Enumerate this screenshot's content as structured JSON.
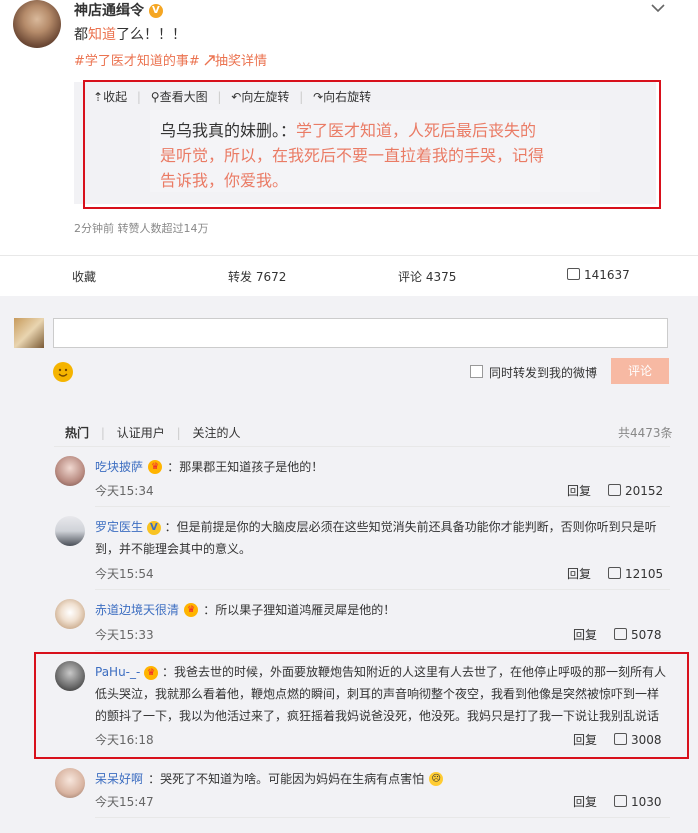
{
  "post": {
    "author": "神店通缉令",
    "verify_icon": "V",
    "text_prefix": "都",
    "text_link": "知道",
    "text_suffix": "了么！！！",
    "hashtag": "#学了医才知道的事#",
    "lottery_link": "抽奖详情",
    "meta": "2分钟前 转赞人数超过14万"
  },
  "image_toolbar": {
    "collapse": "收起",
    "view_large": "查看大图",
    "rotate_left": "向左旋转",
    "rotate_right": "向右旋转"
  },
  "image_text": {
    "lead": "乌乌我真的妹删。：",
    "line1_red": "学了医才知道，人死后最后丧失的",
    "line2": "是听觉，所以，在我死后不要一直拉着我的手哭，记得",
    "line3": "告诉我，你爱我。"
  },
  "actions": {
    "favorite": "收藏",
    "forward": "转发 7672",
    "comment": "评论 4375",
    "like_count": "141637"
  },
  "composer": {
    "placeholder": "",
    "emoji_icon": "smile-icon",
    "forward_checkbox": "同时转发到我的微博",
    "submit": "评论"
  },
  "comment_tabs": {
    "hot": "热门",
    "verified": "认证用户",
    "following": "关注的人",
    "total": "共4473条"
  },
  "comments": [
    {
      "name": "吃块披萨",
      "text": "：那果郡王知道孩子是他的！",
      "time": "今天15:34",
      "reply": "回复",
      "likes": "20152"
    },
    {
      "name": "罗定医生",
      "text1": "：但是前提是你的大脑皮层必须在这些知觉消失前还具备功能你才能判断，否则你听到只是听",
      "text2": "到，并不能理会其中的意义。",
      "time": "今天15:54",
      "reply": "回复",
      "likes": "12105"
    },
    {
      "name": "赤道边境天很清",
      "text": "：所以果子狸知道鸿雁灵犀是他的！",
      "time": "今天15:33",
      "reply": "回复",
      "likes": "5078"
    },
    {
      "name": "PaHu-_-",
      "text1": "：我爸去世的时候，外面要放鞭炮告知附近的人这里有人去世了，在他停止呼吸的那一刻所有人",
      "text2": "低头哭泣，我就那么看着他，鞭炮点燃的瞬间，刺耳的声音响彻整个夜空，我看到他像是突然被惊吓到一样",
      "text3": "的颤抖了一下，我以为他活过来了，疯狂摇着我妈说爸没死，他没死。我妈只是打了我一下说让我别乱说话",
      "time": "今天16:18",
      "reply": "回复",
      "likes": "3008"
    },
    {
      "name": "呆呆好啊",
      "text": "：哭死了不知道为啥。可能因为妈妈在生病有点害怕",
      "time": "今天15:47",
      "reply": "回复",
      "likes": "1030"
    }
  ],
  "colors": {
    "accent": "#eb7350",
    "link": "#3d6ec1",
    "highlight": "#d8101b"
  }
}
